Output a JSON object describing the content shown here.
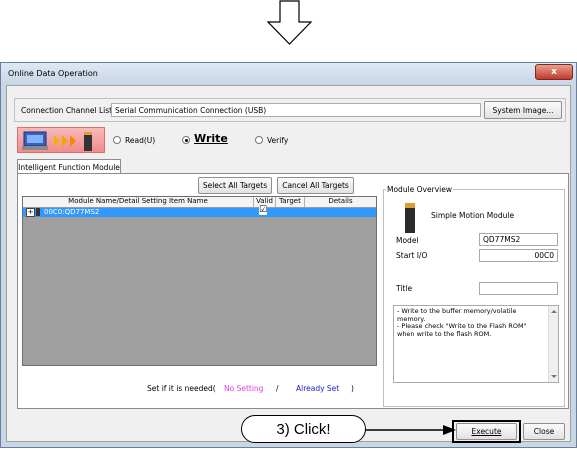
{
  "window": {
    "title": "Online Data Operation",
    "close_glyph": "x"
  },
  "connection": {
    "label": "Connection Channel List",
    "value": "Serial Communication Connection (USB)",
    "system_image_button": "System Image..."
  },
  "mode": {
    "read_label": "Read(U)",
    "write_label": "Write",
    "verify_label": "Verify",
    "selected": "Write"
  },
  "tab": {
    "label": "Intelligent Function Module"
  },
  "toolbar": {
    "select_all": "Select All Targets",
    "cancel_all": "Cancel All Targets"
  },
  "table": {
    "columns": [
      "Module Name/Detail Setting Item Name",
      "Valid",
      "Target",
      "Details"
    ],
    "rows": [
      {
        "expander": "+",
        "name": "00C0:QD77MS2",
        "valid": "☑"
      }
    ]
  },
  "legend": {
    "prefix": "Set if it is needed(",
    "no_setting": "No Setting",
    "separator": "/",
    "already_set": "Already Set",
    "suffix": ")"
  },
  "overview": {
    "group_title": "Module Overview",
    "module_name": "Simple Motion Module",
    "model_label": "Model",
    "model_value": "QD77MS2",
    "start_io_label": "Start I/O",
    "start_io_value": "00C0",
    "title_label": "Title",
    "title_value": "",
    "notes": "- Write to the buffer memory/volatile memory.\n- Please check \"Write to the Flash ROM\" when write to the flash ROM."
  },
  "buttons": {
    "execute": "Execute",
    "close": "Close"
  },
  "callout": {
    "text": "3) Click!"
  },
  "colors": {
    "no_setting": "#e040e0",
    "already_set": "#2020d0",
    "selected_row": "#3399ff",
    "grid_bg": "#a0a0a0"
  }
}
